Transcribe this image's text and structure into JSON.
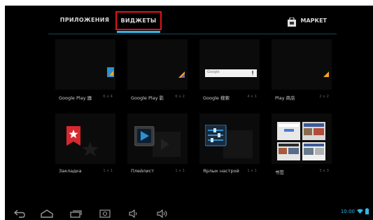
{
  "tabs": {
    "apps_label": "ПРИЛОЖЕНИЯ",
    "widgets_label": "ВИДЖЕТЫ",
    "market_label": "МАРКЕТ"
  },
  "widgets": [
    {
      "label": "Google Play 器",
      "size": "6 x 4"
    },
    {
      "label": "Google Play 影",
      "size": "6 x 2"
    },
    {
      "label": "Google 搜索",
      "size": "4 x 1",
      "search_text": "Google"
    },
    {
      "label": "Play 商店",
      "size": "2 x 2"
    },
    {
      "label": "Закладка",
      "size": "1 x 1"
    },
    {
      "label": "Плейлист",
      "size": "1 x 1"
    },
    {
      "label": "Ярлык настрой",
      "size": "1 x 1"
    },
    {
      "label": "书签",
      "size": "3 x 3"
    }
  ],
  "status": {
    "time": "10:00"
  },
  "colors": {
    "accent": "#33b5e5",
    "highlight": "#e0141d",
    "background": "#000000"
  },
  "icons": [
    "back-icon",
    "home-icon",
    "recent-apps-icon",
    "screenshot-icon",
    "volume-down-icon",
    "volume-up-icon",
    "wifi-icon",
    "battery-icon",
    "market-bag-icon"
  ]
}
